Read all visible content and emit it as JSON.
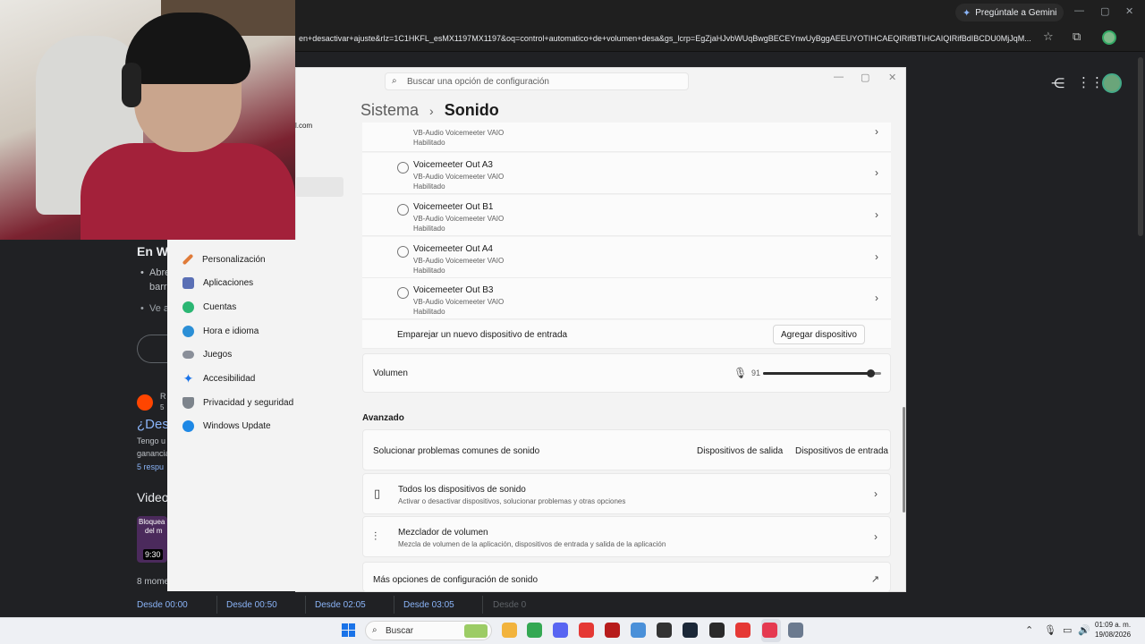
{
  "browser": {
    "gemini_label": "Pregúntale a Gemini",
    "address": "en+desactivar+ajuste&rlz=1C1HKFL_esMX1197MX1197&oq=control+automatico+de+volumen+desa&gs_lcrp=EgZjaHJvbWUqBwgBECEYnwUyBggAEEUYOTIHCAEQIRifBTIHCAIQIRifBdIBCDU0MjJqM..."
  },
  "google": {
    "partial_email": "l.com",
    "heading": "En W",
    "bullet1_line1": "Abre",
    "bullet1_line2": "barr",
    "bullet2": "Ve a",
    "reddit_meta1": "R",
    "reddit_meta2": "5",
    "result_title": "¿Des",
    "snippet1": "Tengo u",
    "snippet2": "ganancia",
    "replies": "5 respu",
    "videos_heading": "Video",
    "video_caption1": "Bloquea",
    "video_caption2": "del m",
    "video_time": "9:30",
    "moments_label": "8 mome",
    "moments": [
      "Desde 00:00",
      "Desde 00:50",
      "Desde 02:05",
      "Desde 03:05",
      "Desde 0"
    ]
  },
  "settings": {
    "search_placeholder": "Buscar una opción de configuración",
    "breadcrumb_parent": "Sistema",
    "breadcrumb_current": "Sonido",
    "nav": [
      {
        "label": "Personalización",
        "color": "#e07b39"
      },
      {
        "label": "Aplicaciones",
        "color": "#5a6fb5"
      },
      {
        "label": "Cuentas",
        "color": "#2bb673"
      },
      {
        "label": "Hora e idioma",
        "color": "#2b8fd6"
      },
      {
        "label": "Juegos",
        "color": "#8a8f99"
      },
      {
        "label": "Accesibilidad",
        "color": "#1a73e8"
      },
      {
        "label": "Privacidad y seguridad",
        "color": "#7d848c"
      },
      {
        "label": "Windows Update",
        "color": "#1e88e5"
      }
    ],
    "devices": [
      {
        "name": "",
        "sub": "VB-Audio Voicemeeter VAIO",
        "status": "Habilitado"
      },
      {
        "name": "Voicemeeter Out A3",
        "sub": "VB-Audio Voicemeeter VAIO",
        "status": "Habilitado"
      },
      {
        "name": "Voicemeeter Out B1",
        "sub": "VB-Audio Voicemeeter VAIO",
        "status": "Habilitado"
      },
      {
        "name": "Voicemeeter Out A4",
        "sub": "VB-Audio Voicemeeter VAIO",
        "status": "Habilitado"
      },
      {
        "name": "Voicemeeter Out B3",
        "sub": "VB-Audio Voicemeeter VAIO",
        "status": "Habilitado"
      }
    ],
    "pair_label": "Emparejar un nuevo dispositivo de entrada",
    "add_device_label": "Agregar dispositivo",
    "volume_label": "Volumen",
    "volume_value": "91",
    "volume_level": 0.91,
    "advanced_label": "Avanzado",
    "troubleshoot_label": "Solucionar problemas comunes de sonido",
    "output_devices_label": "Dispositivos de salida",
    "input_devices_label": "Dispositivos de entrada",
    "all_devices_title": "Todos los dispositivos de sonido",
    "all_devices_sub": "Activar o desactivar dispositivos, solucionar problemas y otras opciones",
    "mixer_title": "Mezclador de volumen",
    "mixer_sub": "Mezcla de volumen de la aplicación, dispositivos de entrada y salida de la aplicación",
    "more_options_label": "Más opciones de configuración de sonido"
  },
  "taskbar": {
    "search_label": "Buscar",
    "time": "01:09 a. m.",
    "date": "19/08/2026",
    "apps": [
      {
        "name": "file-explorer-icon",
        "color": "#f2b33d"
      },
      {
        "name": "chrome-icon",
        "color": "#34a853"
      },
      {
        "name": "discord-icon",
        "color": "#5865f2"
      },
      {
        "name": "youtube-icon",
        "color": "#e53935"
      },
      {
        "name": "game-icon",
        "color": "#b71c1c"
      },
      {
        "name": "app-icon",
        "color": "#4a90d9"
      },
      {
        "name": "app-icon-2",
        "color": "#333333"
      },
      {
        "name": "steam-icon",
        "color": "#1b2838"
      },
      {
        "name": "epic-icon",
        "color": "#2a2a2a"
      },
      {
        "name": "app-icon-3",
        "color": "#e53935"
      },
      {
        "name": "app-icon-4",
        "color": "#e53950"
      },
      {
        "name": "settings-icon",
        "color": "#6b7a8f"
      }
    ]
  }
}
